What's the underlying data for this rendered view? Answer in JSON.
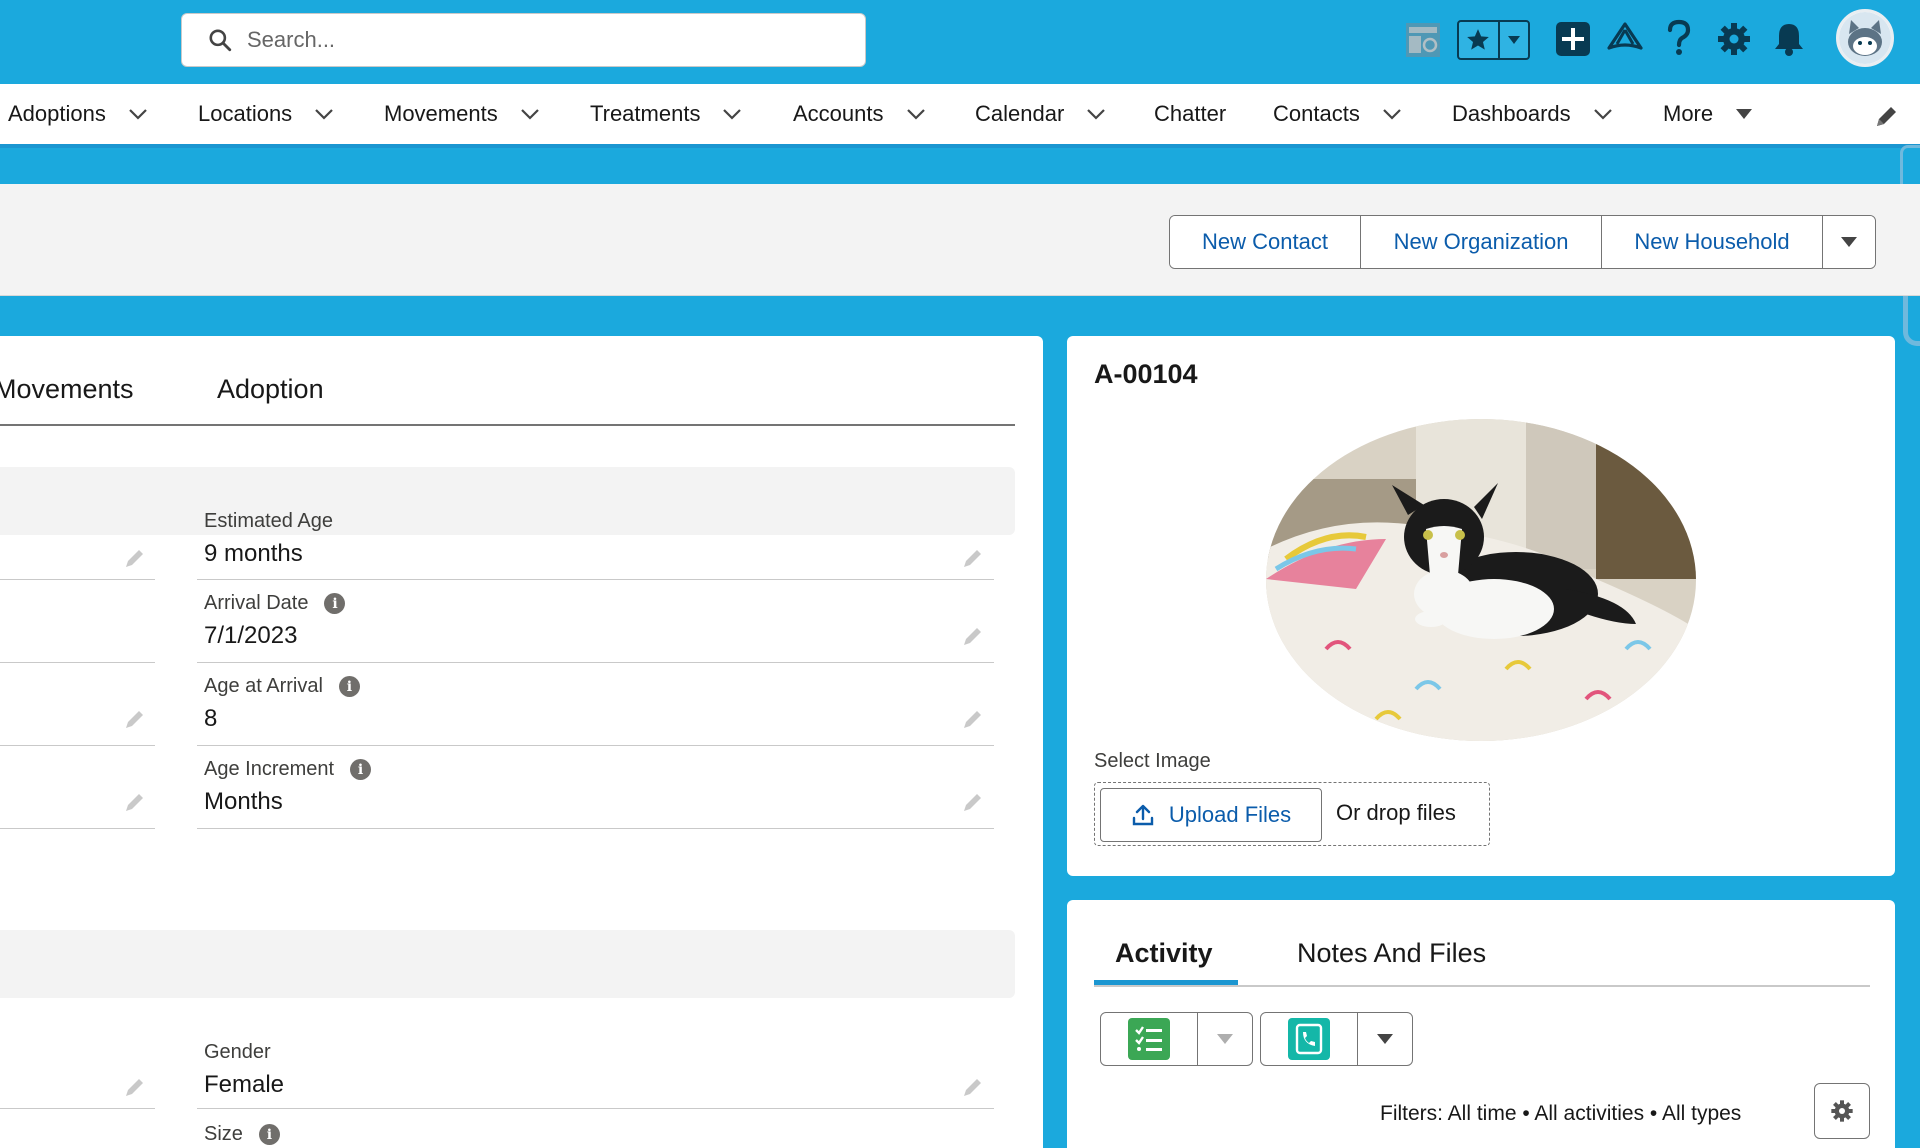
{
  "search": {
    "placeholder": "Search..."
  },
  "nav": {
    "items": [
      {
        "label": "Adoptions"
      },
      {
        "label": "Locations"
      },
      {
        "label": "Movements"
      },
      {
        "label": "Treatments"
      },
      {
        "label": "Accounts"
      },
      {
        "label": "Calendar"
      },
      {
        "label": "Chatter"
      },
      {
        "label": "Contacts"
      },
      {
        "label": "Dashboards"
      },
      {
        "label": "More"
      }
    ]
  },
  "actions": {
    "new_contact": "New Contact",
    "new_organization": "New Organization",
    "new_household": "New Household"
  },
  "record_tabs": [
    "Movements",
    "Adoption"
  ],
  "fields": {
    "estimated_age": {
      "label": "Estimated Age",
      "value": "9 months"
    },
    "arrival_date": {
      "label": "Arrival Date",
      "value": "7/1/2023"
    },
    "age_at_arrival": {
      "label": "Age at Arrival",
      "value": "8"
    },
    "age_increment": {
      "label": "Age Increment",
      "value": "Months"
    },
    "gender": {
      "label": "Gender",
      "value": "Female"
    },
    "size": {
      "label": "Size",
      "value": ""
    }
  },
  "record": {
    "title": "A-00104",
    "select_image_label": "Select Image",
    "upload_label": "Upload Files",
    "drop_label": "Or drop files"
  },
  "activity": {
    "tabs": [
      "Activity",
      "Notes And Files"
    ],
    "filters": "Filters: All time • All activities • All types"
  },
  "colors": {
    "brand_blue": "#1ba9dd",
    "link_blue": "#0b5cab",
    "task_green": "#3ba755",
    "call_teal": "#14b7a8"
  }
}
